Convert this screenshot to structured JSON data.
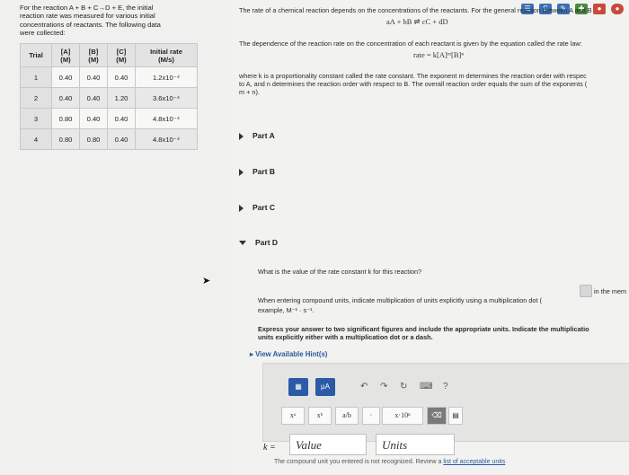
{
  "left": {
    "intro_lines": [
      "For the reaction A + B + C→D + E, the initial",
      "reaction rate was measured for various initial",
      "concentrations of reactants. The following data",
      "were collected:"
    ],
    "table": {
      "headers": [
        "Trial",
        "[A]",
        "(M)",
        "[B]",
        "(M)",
        "[C]",
        "(M)",
        "Initial rate",
        "(M/s)"
      ],
      "rows": [
        [
          "1",
          "0.40",
          "0.40",
          "0.40",
          "1.2x10⁻⁴"
        ],
        [
          "2",
          "0.40",
          "0.40",
          "1.20",
          "3.6x10⁻⁴"
        ],
        [
          "3",
          "0.80",
          "0.40",
          "0.40",
          "4.8x10⁻⁴"
        ],
        [
          "4",
          "0.80",
          "0.80",
          "0.40",
          "4.8x10⁻⁴"
        ]
      ]
    }
  },
  "right": {
    "para1": "The rate of a chemical reaction depends on the concentrations of the reactants. For the general reaction between A and B",
    "eq1": "aA + bB ⇌ cC + dD",
    "para2": "The dependence of the reaction rate on the concentration of each reactant is given by the equation called the rate law:",
    "eq2": "rate = k[A]ᵐ[B]ⁿ",
    "para3_lines": [
      "where k is a proportionality constant called the rate constant. The exponent m determines the reaction order with respec",
      "to A, and n determines the reaction order with respect to B. The overall reaction order equals the sum of the exponents (",
      "m + n)."
    ],
    "parts": [
      {
        "label": "Part A"
      },
      {
        "label": "Part B"
      },
      {
        "label": "Part C"
      },
      {
        "label": "Part D"
      }
    ],
    "question": "What is the value of the rate constant k for this reaction?",
    "units_note_1": "When entering compound units, indicate multiplication of units explicitly using a multiplication dot (",
    "units_note_1_end": "in the mem",
    "units_note_2": "example, M⁻¹ · s⁻¹.",
    "instruction_1": "Express your answer to two significant figures and include the appropriate units. Indicate the multiplicatio",
    "instruction_2": "units explicitly either with a multiplication dot or a dash.",
    "hint_label": "View Available Hint(s)",
    "editor": {
      "mu_label": "μA",
      "tools": [
        "xᵃ",
        "xᵇ",
        "a/b",
        "·",
        "x·10ⁿ"
      ],
      "help": "?"
    },
    "answer_label": "k =",
    "value_placeholder": "Value",
    "units_placeholder": "Units",
    "error_text": "The compound unit you entered is not recognized. Review a ",
    "error_link": "list of acceptable units"
  },
  "colors": {
    "editor_blue": "#2b5ba6",
    "link": "#2a5aa0"
  }
}
